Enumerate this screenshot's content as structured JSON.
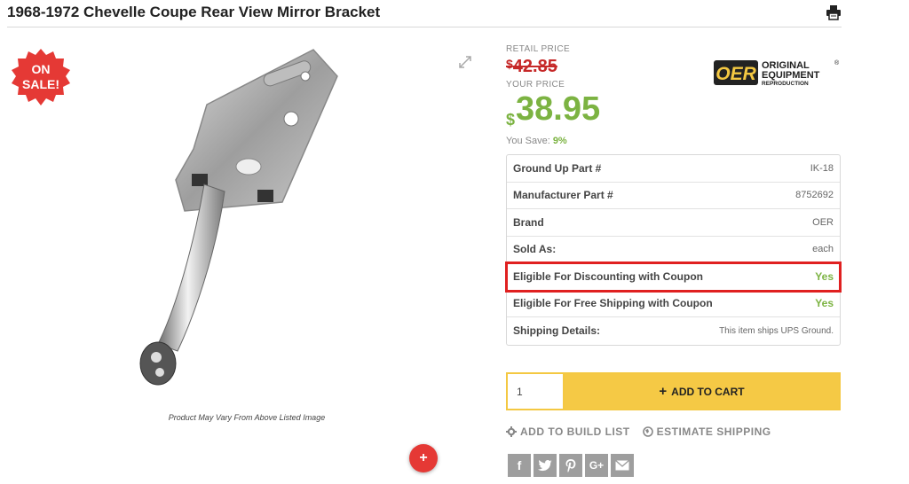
{
  "product": {
    "title": "1968-1972 Chevelle Coupe Rear View Mirror Bracket",
    "caption": "Product May Vary From Above Listed Image"
  },
  "badge": {
    "line1": "ON",
    "line2": "SALE!"
  },
  "pricing": {
    "retail_label": "RETAIL PRICE",
    "retail_currency": "$",
    "retail_amount": "42.85",
    "your_label": "YOUR PRICE",
    "your_currency": "$",
    "your_amount": "38.95",
    "save_label": "You Save:",
    "save_value": "9%"
  },
  "brand_logo": {
    "mark": "OER",
    "line1": "ORIGINAL",
    "line2": "EQUIPMENT",
    "line3": "REPRODUCTION",
    "registered": "®"
  },
  "specs": [
    {
      "label": "Ground Up Part #",
      "value": "IK-18"
    },
    {
      "label": "Manufacturer Part #",
      "value": "8752692"
    },
    {
      "label": "Brand",
      "value": "OER"
    },
    {
      "label": "Sold As:",
      "value": "each"
    },
    {
      "label": "Eligible For Discounting with Coupon",
      "value": "Yes"
    },
    {
      "label": "Eligible For Free Shipping with Coupon",
      "value": "Yes"
    },
    {
      "label": "Shipping Details:",
      "value": "This item ships UPS Ground."
    }
  ],
  "cart": {
    "quantity": "1",
    "add_label": "ADD TO CART",
    "add_icon": "+"
  },
  "links": {
    "build_list": "ADD TO BUILD LIST",
    "estimate_shipping": "ESTIMATE SHIPPING"
  },
  "share": {
    "facebook": "f",
    "google_plus": "G+"
  },
  "plus_button": "+",
  "colors": {
    "sale_green": "#7cb342",
    "retail_red": "#c62828",
    "cart_yellow": "#f5c945",
    "highlight_red": "#e02020",
    "sale_badge_red": "#e53935"
  }
}
